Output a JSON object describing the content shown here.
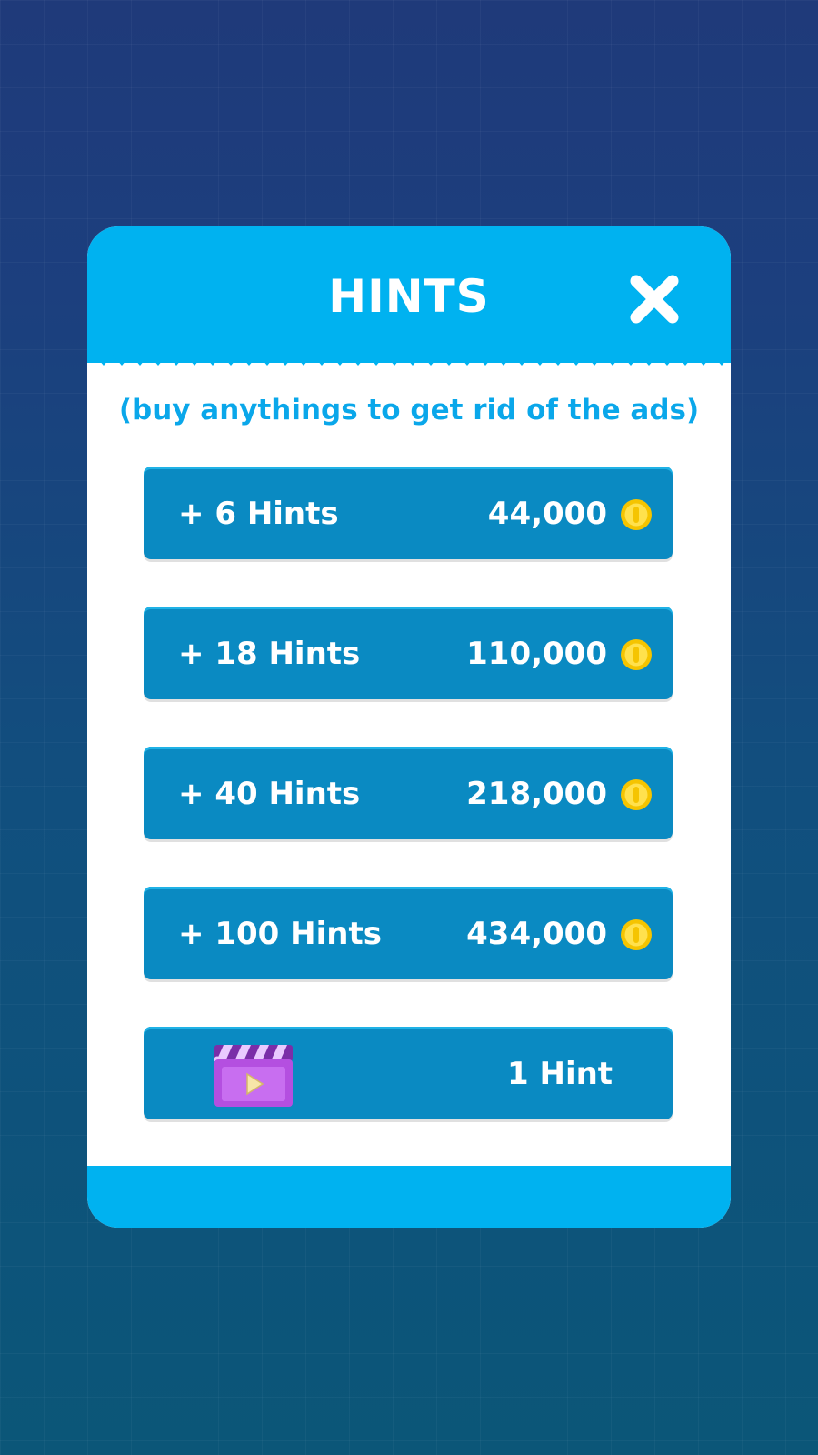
{
  "dialog": {
    "title": "HINTS",
    "subtitle": "(buy anythings to get rid of the ads)",
    "close_icon": "close-icon"
  },
  "offers": [
    {
      "label": "+ 6 Hints",
      "price": "44,000",
      "icon": "coin-icon"
    },
    {
      "label": "+ 18 Hints",
      "price": "110,000",
      "icon": "coin-icon"
    },
    {
      "label": "+ 40 Hints",
      "price": "218,000",
      "icon": "coin-icon"
    },
    {
      "label": "+ 100 Hints",
      "price": "434,000",
      "icon": "coin-icon"
    }
  ],
  "video_offer": {
    "label": "1 Hint",
    "icon": "video-clapperboard-icon"
  },
  "colors": {
    "header_blue": "#00b2f0",
    "button_blue": "#0a8ac2",
    "subtitle_blue": "#0aa7ea",
    "coin_gold": "#f5c400",
    "video_purple": "#b44fe0"
  }
}
